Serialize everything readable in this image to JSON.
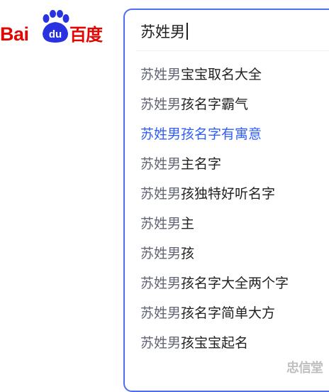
{
  "logo": {
    "latin": "Bai",
    "paw_glyph": "du",
    "chinese": "百度",
    "color": "#e10601",
    "icon": "baidu-paw-icon"
  },
  "search": {
    "value": "苏姓男",
    "border_color": "#4e6ef2"
  },
  "suggestions": [
    {
      "query": "苏姓男",
      "rest": "宝宝取名大全"
    },
    {
      "query": "苏姓男",
      "rest": "孩名字霸气"
    },
    {
      "query": "苏姓男",
      "rest": "孩名字有寓意"
    },
    {
      "query": "苏姓男",
      "rest": "主名字"
    },
    {
      "query": "苏姓男",
      "rest": "孩独特好听名字"
    },
    {
      "query": "苏姓男",
      "rest": "主"
    },
    {
      "query": "苏姓男",
      "rest": "孩"
    },
    {
      "query": "苏姓男",
      "rest": "孩名字大全两个字"
    },
    {
      "query": "苏姓男",
      "rest": "孩名字简单大方"
    },
    {
      "query": "苏姓男",
      "rest": "孩宝宝起名"
    }
  ],
  "highlight_color": "#315efb",
  "watermark": "忠信堂"
}
